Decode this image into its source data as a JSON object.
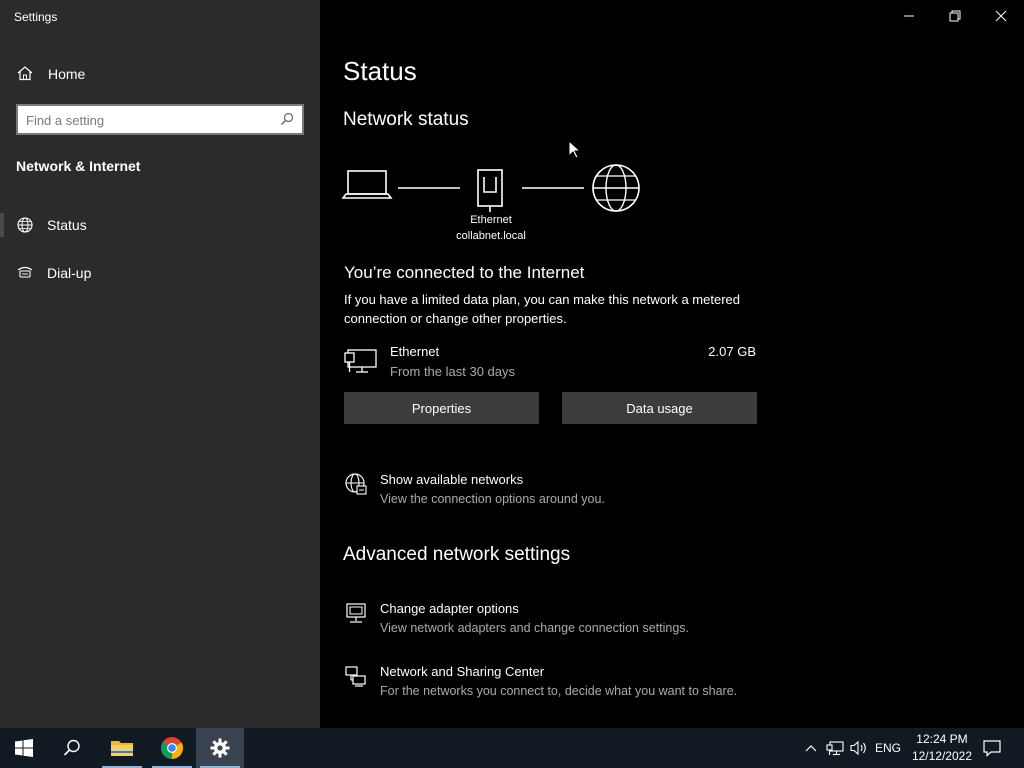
{
  "window": {
    "title": "Settings",
    "controls": [
      "minimize",
      "restore",
      "close"
    ]
  },
  "sidebar": {
    "home_label": "Home",
    "search": {
      "placeholder": "Find a setting",
      "value": ""
    },
    "section_title": "Network & Internet",
    "items": [
      {
        "label": "Status",
        "icon": "globe-icon",
        "selected": true
      },
      {
        "label": "Dial-up",
        "icon": "dialup-icon",
        "selected": false
      }
    ]
  },
  "main": {
    "page_title": "Status",
    "network_status": {
      "heading": "Network status",
      "adapter_label": "Ethernet",
      "domain_label": "collabnet.local"
    },
    "connection": {
      "title": "You’re connected to the Internet",
      "description": "If you have a limited data plan, you can make this network a metered connection or change other properties."
    },
    "ethernet": {
      "name": "Ethernet",
      "period": "From the last 30 days",
      "usage": "2.07 GB"
    },
    "buttons": {
      "properties": "Properties",
      "data_usage": "Data usage"
    },
    "show_networks": {
      "title": "Show available networks",
      "description": "View the connection options around you."
    },
    "advanced": {
      "heading": "Advanced network settings",
      "items": [
        {
          "title": "Change adapter options",
          "description": "View network adapters and change connection settings."
        },
        {
          "title": "Network and Sharing Center",
          "description": "For the networks you connect to, decide what you want to share."
        }
      ]
    }
  },
  "taskbar": {
    "apps": [
      "start",
      "search",
      "file-explorer",
      "chrome",
      "settings"
    ],
    "language": "ENG",
    "time": "12:24 PM",
    "date": "12/12/2022"
  },
  "colors": {
    "sidebar_bg": "#2b2b2b",
    "main_bg": "#000000",
    "button_bg": "#3c3c3c",
    "taskbar_bg": "#111a22",
    "secondary_text": "#aaaaaa"
  }
}
